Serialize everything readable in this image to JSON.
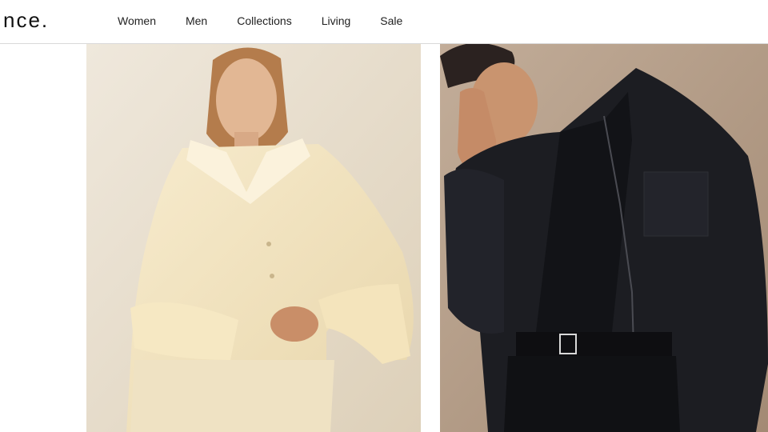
{
  "brand": {
    "logo_text": "nce."
  },
  "nav": {
    "items": [
      {
        "label": "Women"
      },
      {
        "label": "Men"
      },
      {
        "label": "Collections"
      },
      {
        "label": "Living"
      },
      {
        "label": "Sale"
      }
    ]
  },
  "colors": {
    "left_photo_bg": "#ece4d5",
    "left_garment": "#f3e6c4",
    "right_photo_bg": "#b7a18c",
    "right_garment": "#1c1d22"
  },
  "hero": {
    "left_image": {
      "subject": "woman-in-cream-shirt-photo"
    },
    "right_image": {
      "subject": "man-in-black-jacket-photo"
    }
  }
}
